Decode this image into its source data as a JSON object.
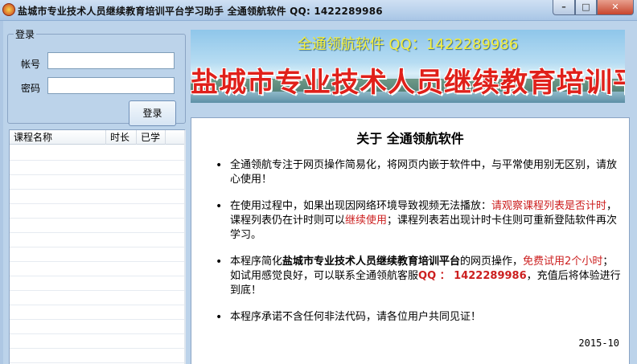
{
  "window": {
    "title": "盐城市专业技术人员继续教育培训平台学习助手  全通领航软件  QQ: 1422289986",
    "minimize": "–",
    "maximize": "□",
    "close": "✕"
  },
  "login": {
    "legend": "登录",
    "account_label": "帐号",
    "password_label": "密码",
    "account_value": "",
    "password_value": "",
    "submit_label": "登录"
  },
  "course_list": {
    "columns": [
      "课程名称",
      "时长",
      "已学"
    ],
    "rows": []
  },
  "banner": {
    "subtitle": "全通领航软件 QQ：1422289986",
    "title": "盐城市专业技术人员继续教育培训平台"
  },
  "about": {
    "title": "关于  全通领航软件",
    "p1": "全通领航专注于网页操作简易化，将网页内嵌于软件中，与平常使用别无区别，请放心使用！",
    "p2_a": "在使用过程中，如果出现因网络环境导致视频无法播放：",
    "p2_red1": "请观察课程列表是否计时",
    "p2_b": "，课程列表仍在计时则可以",
    "p2_red2": "继续使用",
    "p2_c": "；课程列表若出现计时卡住则可重新登陆软件再次学习。",
    "p3_a": "本程序简化",
    "p3_bold": "盐城市专业技术人员继续教育培训平台",
    "p3_b": "的网页操作，",
    "p3_red": "免费试用2个小时",
    "p3_c": "；如试用感觉良好，可以联系全通领航客服",
    "p3_qq": "QQ ： 1422289986",
    "p3_d": "，充值后将体验进行到底！",
    "p4": "本程序承诺不含任何非法代码，请各位用户共同见证！",
    "date": "2015-10"
  },
  "colors": {
    "window_bg": "#bcd3ea",
    "accent_red": "#cc1f1f",
    "banner_title": "#e0201a",
    "banner_subtitle": "#f5ee3a"
  }
}
